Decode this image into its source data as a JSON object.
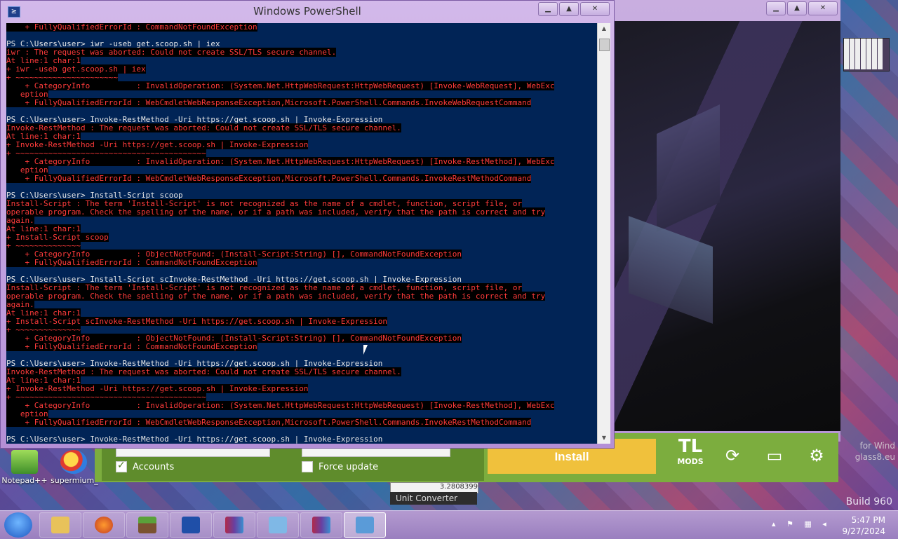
{
  "powershell": {
    "title": "Windows PowerShell",
    "lines": [
      {
        "t": "    + FullyQualifiedErrorId : CommandNotFoundException",
        "e": true
      },
      {
        "t": "",
        "e": false
      },
      {
        "t": "PS C:\\Users\\user> iwr -useb get.scoop.sh | iex",
        "e": false
      },
      {
        "t": "iwr : The request was aborted: Could not create SSL/TLS secure channel.",
        "e": true
      },
      {
        "t": "At line:1 char:1",
        "e": true
      },
      {
        "t": "+ iwr -useb get.scoop.sh | iex",
        "e": true
      },
      {
        "t": "+ ~~~~~~~~~~~~~~~~~~~~~~",
        "e": true
      },
      {
        "t": "    + CategoryInfo          : InvalidOperation: (System.Net.HttpWebRequest:HttpWebRequest) [Invoke-WebRequest], WebExc",
        "e": true
      },
      {
        "t": "   eption",
        "e": true
      },
      {
        "t": "    + FullyQualifiedErrorId : WebCmdletWebResponseException,Microsoft.PowerShell.Commands.InvokeWebRequestCommand",
        "e": true
      },
      {
        "t": "",
        "e": false
      },
      {
        "t": "PS C:\\Users\\user> Invoke-RestMethod -Uri https://get.scoop.sh | Invoke-Expression",
        "e": false
      },
      {
        "t": "Invoke-RestMethod : The request was aborted: Could not create SSL/TLS secure channel.",
        "e": true
      },
      {
        "t": "At line:1 char:1",
        "e": true
      },
      {
        "t": "+ Invoke-RestMethod -Uri https://get.scoop.sh | Invoke-Expression",
        "e": true
      },
      {
        "t": "+ ~~~~~~~~~~~~~~~~~~~~~~~~~~~~~~~~~~~~~~~~~",
        "e": true
      },
      {
        "t": "    + CategoryInfo          : InvalidOperation: (System.Net.HttpWebRequest:HttpWebRequest) [Invoke-RestMethod], WebExc",
        "e": true
      },
      {
        "t": "   eption",
        "e": true
      },
      {
        "t": "    + FullyQualifiedErrorId : WebCmdletWebResponseException,Microsoft.PowerShell.Commands.InvokeRestMethodCommand",
        "e": true
      },
      {
        "t": "",
        "e": false
      },
      {
        "t": "PS C:\\Users\\user> Install-Script scoop",
        "e": false
      },
      {
        "t": "Install-Script : The term 'Install-Script' is not recognized as the name of a cmdlet, function, script file, or",
        "e": true
      },
      {
        "t": "operable program. Check the spelling of the name, or if a path was included, verify that the path is correct and try",
        "e": true
      },
      {
        "t": "again.",
        "e": true
      },
      {
        "t": "At line:1 char:1",
        "e": true
      },
      {
        "t": "+ Install-Script scoop",
        "e": true
      },
      {
        "t": "+ ~~~~~~~~~~~~~~",
        "e": true
      },
      {
        "t": "    + CategoryInfo          : ObjectNotFound: (Install-Script:String) [], CommandNotFoundException",
        "e": true
      },
      {
        "t": "    + FullyQualifiedErrorId : CommandNotFoundException",
        "e": true
      },
      {
        "t": "",
        "e": false
      },
      {
        "t": "PS C:\\Users\\user> Install-Script scInvoke-RestMethod -Uri https://get.scoop.sh | Invoke-Expression",
        "e": false
      },
      {
        "t": "Install-Script : The term 'Install-Script' is not recognized as the name of a cmdlet, function, script file, or",
        "e": true
      },
      {
        "t": "operable program. Check the spelling of the name, or if a path was included, verify that the path is correct and try",
        "e": true
      },
      {
        "t": "again.",
        "e": true
      },
      {
        "t": "At line:1 char:1",
        "e": true
      },
      {
        "t": "+ Install-Script scInvoke-RestMethod -Uri https://get.scoop.sh | Invoke-Expression",
        "e": true
      },
      {
        "t": "+ ~~~~~~~~~~~~~~",
        "e": true
      },
      {
        "t": "    + CategoryInfo          : ObjectNotFound: (Install-Script:String) [], CommandNotFoundException",
        "e": true
      },
      {
        "t": "    + FullyQualifiedErrorId : CommandNotFoundException",
        "e": true
      },
      {
        "t": "",
        "e": false
      },
      {
        "t": "PS C:\\Users\\user> Invoke-RestMethod -Uri https://get.scoop.sh | Invoke-Expression",
        "e": false
      },
      {
        "t": "Invoke-RestMethod : The request was aborted: Could not create SSL/TLS secure channel.",
        "e": true
      },
      {
        "t": "At line:1 char:1",
        "e": true
      },
      {
        "t": "+ Invoke-RestMethod -Uri https://get.scoop.sh | Invoke-Expression",
        "e": true
      },
      {
        "t": "+ ~~~~~~~~~~~~~~~~~~~~~~~~~~~~~~~~~~~~~~~~~",
        "e": true
      },
      {
        "t": "    + CategoryInfo          : InvalidOperation: (System.Net.HttpWebRequest:HttpWebRequest) [Invoke-RestMethod], WebExc",
        "e": true
      },
      {
        "t": "   eption",
        "e": true
      },
      {
        "t": "    + FullyQualifiedErrorId : WebCmdletWebResponseException,Microsoft.PowerShell.Commands.InvokeRestMethodCommand",
        "e": true
      },
      {
        "t": "",
        "e": false
      },
      {
        "t": "PS C:\\Users\\user> Invoke-RestMethod -Uri https://get.scoop.sh | Invoke-Expression",
        "e": false
      }
    ]
  },
  "installer": {
    "accounts_label": "Accounts",
    "force_update_label": "Force update",
    "install_label": "Install",
    "logo_top": "TL",
    "logo_bottom": "MODS"
  },
  "desktop": {
    "icon1": "Notepad++",
    "icon2": "supermium_",
    "bg_text1": "for Wind",
    "bg_text2": "glass8.eu",
    "build": "Build 960"
  },
  "unit_converter": {
    "label": "Unit Converter",
    "value": "3.2808399"
  },
  "taskbar": {
    "time": "5:47 PM",
    "date": "9/27/2024"
  },
  "colors": {
    "console_bg": "#012456",
    "error_text": "#ff3b3b",
    "installer_green": "#7cad3e",
    "install_button": "#f0c13c"
  }
}
